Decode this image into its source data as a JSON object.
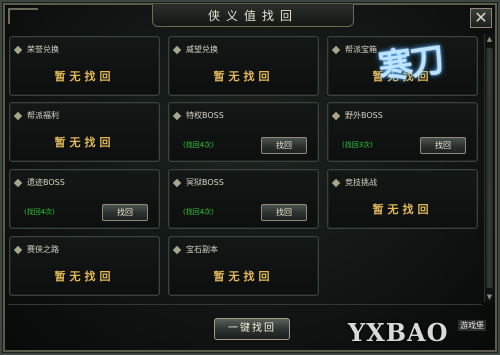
{
  "window": {
    "title": "侠义值找回",
    "close_label": "✕"
  },
  "cards": [
    {
      "title": "荣誉兑换",
      "status": "暂无找回",
      "count": "",
      "button": ""
    },
    {
      "title": "威望兑换",
      "status": "暂无找回",
      "count": "",
      "button": ""
    },
    {
      "title": "帮派宝箱",
      "status": "暂无找回",
      "count": "",
      "button": ""
    },
    {
      "title": "帮派福利",
      "status": "暂无找回",
      "count": "",
      "button": ""
    },
    {
      "title": "特权BOSS",
      "status": "",
      "count": "(找回4次)",
      "button": "找回"
    },
    {
      "title": "野外BOSS",
      "status": "",
      "count": "(找回3次)",
      "button": "找回"
    },
    {
      "title": "遗迹BOSS",
      "status": "",
      "count": "(找回4次)",
      "button": "找回"
    },
    {
      "title": "冥狱BOSS",
      "status": "",
      "count": "(找回4次)",
      "button": "找回"
    },
    {
      "title": "竞技挑战",
      "status": "暂无找回",
      "count": "",
      "button": ""
    },
    {
      "title": "赛侠之路",
      "status": "暂无找回",
      "count": "",
      "button": ""
    },
    {
      "title": "宝石副本",
      "status": "暂无找回",
      "count": "",
      "button": ""
    }
  ],
  "footer": {
    "one_key_label": "一键找回"
  },
  "logo": {
    "text": "寒刀"
  },
  "watermark": {
    "text": "YXBAO",
    "sub": "游戏堡"
  },
  "colors": {
    "status": "#e2b858",
    "count": "#34c43a",
    "border": "#3a423c"
  }
}
